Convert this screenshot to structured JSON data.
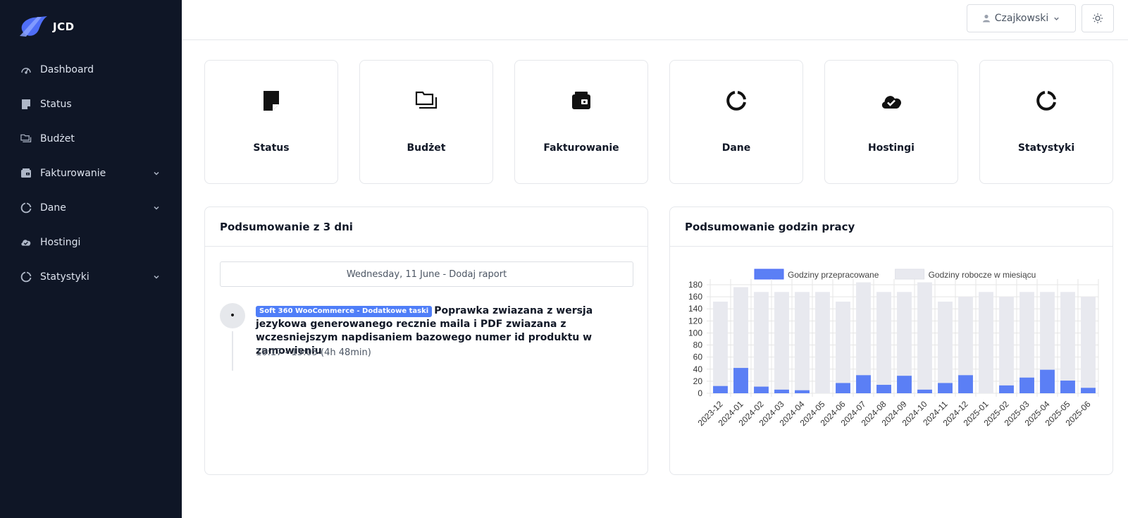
{
  "brand": {
    "name": "JCD",
    "accent": "#4f6ef7"
  },
  "sidebar": {
    "items": [
      {
        "label": "Dashboard",
        "icon": "speedometer-icon",
        "expandable": false
      },
      {
        "label": "Status",
        "icon": "sticky-note-icon",
        "expandable": false
      },
      {
        "label": "Budżet",
        "icon": "folders-icon",
        "expandable": false
      },
      {
        "label": "Fakturowanie",
        "icon": "wallet-icon",
        "expandable": true
      },
      {
        "label": "Dane",
        "icon": "circle-progress-icon",
        "expandable": true
      },
      {
        "label": "Hostingi",
        "icon": "cloud-check-icon",
        "expandable": false
      },
      {
        "label": "Statystyki",
        "icon": "circle-progress-icon",
        "expandable": true
      }
    ]
  },
  "topbar": {
    "user": "Czajkowski",
    "theme_icon": "sun-icon"
  },
  "tiles": [
    {
      "label": "Status",
      "icon": "sticky-note-icon"
    },
    {
      "label": "Budżet",
      "icon": "folders-icon"
    },
    {
      "label": "Fakturowanie",
      "icon": "wallet-icon"
    },
    {
      "label": "Dane",
      "icon": "circle-progress-icon"
    },
    {
      "label": "Hostingi",
      "icon": "cloud-check-icon"
    },
    {
      "label": "Statystyki",
      "icon": "circle-progress-icon"
    }
  ],
  "summary": {
    "title": "Podsumowanie z 3 dni",
    "date_bar": "Wednesday, 11 June - Dodaj raport",
    "entry": {
      "badge": "Soft 360 WooCommerce - Dodatkowe taski",
      "text": "Poprawka zwiazana z wersja jezykowa generowanego recznie maila i PDF zwiazana z wczesniejszym napdisaniem bazowego numer id produktu w zamowieniu",
      "time": "10:17 - 15:05 (4h 48min)",
      "dot": "•"
    }
  },
  "hours_card": {
    "title": "Podsumowanie godzin pracy"
  },
  "chart_data": {
    "type": "bar",
    "stacked": false,
    "categories": [
      "2023-12",
      "2024-01",
      "2024-02",
      "2024-03",
      "2024-04",
      "2024-05",
      "2024-06",
      "2024-07",
      "2024-08",
      "2024-09",
      "2024-10",
      "2024-11",
      "2024-12",
      "2025-01",
      "2025-02",
      "2025-03",
      "2025-04",
      "2025-05",
      "2025-06"
    ],
    "series": [
      {
        "name": "Godziny przepracowane",
        "color": "#5b7ff5",
        "values": [
          12,
          42,
          11,
          6,
          5,
          0,
          17,
          30,
          14,
          29,
          6,
          17,
          30,
          0,
          13,
          26,
          39,
          21,
          9
        ]
      },
      {
        "name": "Godziny robocze w miesiącu",
        "color": "#e8e9ef",
        "values": [
          152,
          176,
          168,
          168,
          168,
          168,
          152,
          184,
          168,
          168,
          184,
          152,
          160,
          168,
          160,
          168,
          168,
          168,
          160
        ]
      }
    ],
    "ylim": [
      0,
      180
    ],
    "yticks": [
      0,
      20,
      40,
      60,
      80,
      100,
      120,
      140,
      160,
      180
    ],
    "grid": true,
    "legend": "top"
  }
}
